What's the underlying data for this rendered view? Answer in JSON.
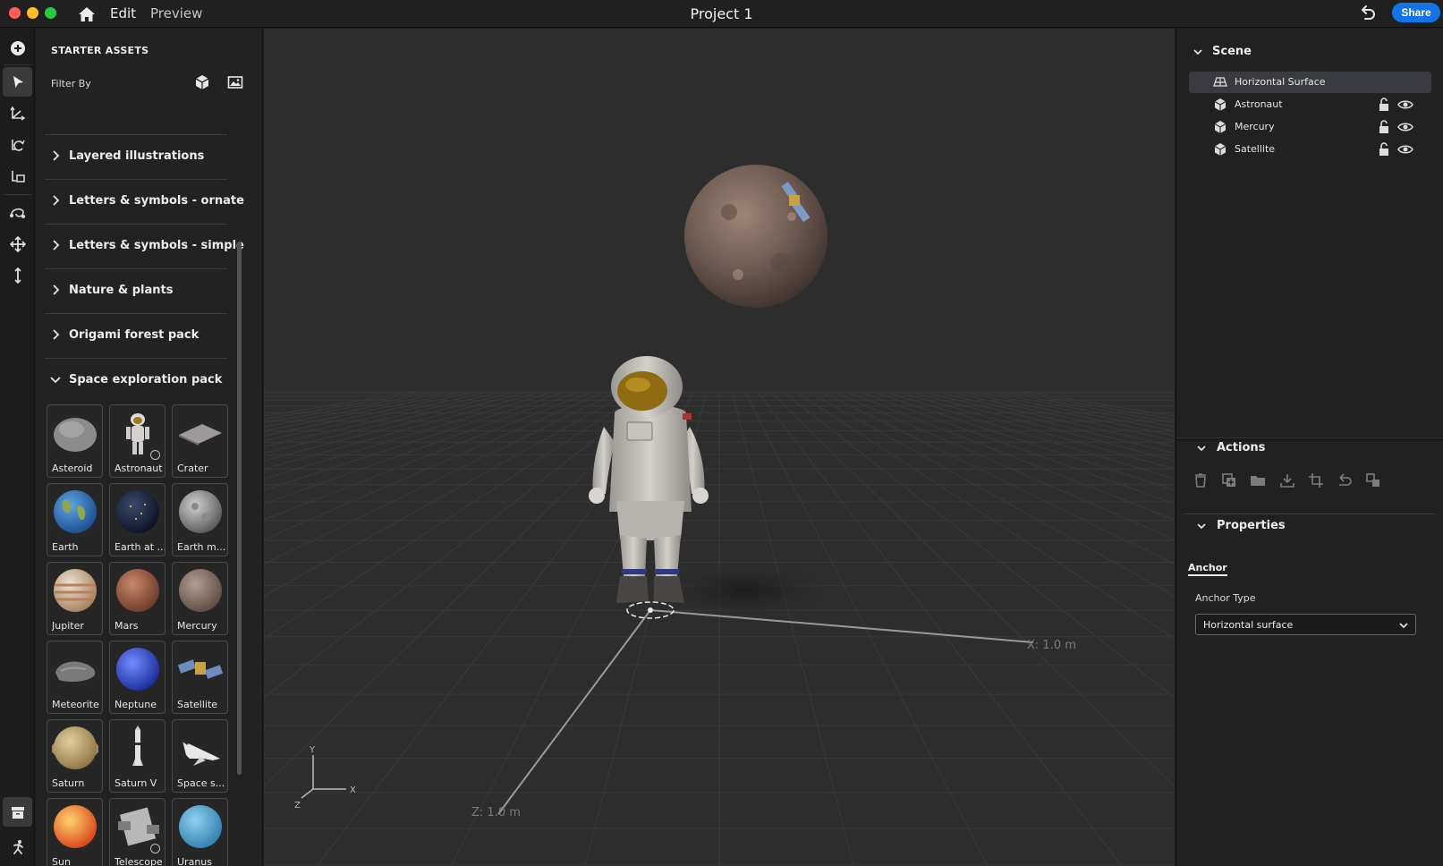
{
  "titlebar": {
    "menu": [
      "Edit",
      "Preview"
    ],
    "project_title": "Project 1",
    "share_label": "Share"
  },
  "assets": {
    "title": "STARTER ASSETS",
    "filter_label": "Filter By",
    "categories": [
      {
        "label": "Layered illustrations",
        "expanded": false
      },
      {
        "label": "Letters & symbols - ornate",
        "expanded": false
      },
      {
        "label": "Letters & symbols - simple",
        "expanded": false
      },
      {
        "label": "Nature & plants",
        "expanded": false
      },
      {
        "label": "Origami forest pack",
        "expanded": false
      },
      {
        "label": "Space exploration pack",
        "expanded": true
      }
    ],
    "tiles": [
      {
        "label": "Asteroid",
        "icon": "asteroid-icon"
      },
      {
        "label": "Astronaut",
        "icon": "astronaut-icon",
        "animated": true
      },
      {
        "label": "Crater",
        "icon": "crater-icon"
      },
      {
        "label": "Earth",
        "icon": "earth-icon"
      },
      {
        "label": "Earth at ...",
        "icon": "earth-night-icon"
      },
      {
        "label": "Earth m...",
        "icon": "earth-moon-icon"
      },
      {
        "label": "Jupiter",
        "icon": "jupiter-icon"
      },
      {
        "label": "Mars",
        "icon": "mars-icon"
      },
      {
        "label": "Mercury",
        "icon": "mercury-icon"
      },
      {
        "label": "Meteorite",
        "icon": "meteorite-icon"
      },
      {
        "label": "Neptune",
        "icon": "neptune-icon"
      },
      {
        "label": "Satellite",
        "icon": "satellite-icon"
      },
      {
        "label": "Saturn",
        "icon": "saturn-icon"
      },
      {
        "label": "Saturn V",
        "icon": "rocket-icon"
      },
      {
        "label": "Space s...",
        "icon": "space-shuttle-icon"
      },
      {
        "label": "Sun",
        "icon": "sun-icon"
      },
      {
        "label": "Telescope",
        "icon": "telescope-icon",
        "animated": true
      },
      {
        "label": "Uranus",
        "icon": "uranus-icon"
      }
    ]
  },
  "viewport": {
    "axis_x_label": "X: 1.0 m",
    "axis_z_label": "Z: 1.0 m",
    "gizmo": {
      "x": "X",
      "y": "Y",
      "z": "Z"
    }
  },
  "scene": {
    "title": "Scene",
    "items": [
      {
        "label": "Horizontal Surface",
        "icon": "surface-icon",
        "selected": true
      },
      {
        "label": "Astronaut",
        "icon": "cube-icon",
        "selected": false
      },
      {
        "label": "Mercury",
        "icon": "cube-icon",
        "selected": false
      },
      {
        "label": "Satellite",
        "icon": "cube-icon",
        "selected": false
      }
    ]
  },
  "actions": {
    "title": "Actions",
    "icons": [
      "trash-icon",
      "duplicate-icon",
      "group-folder-icon",
      "drop-to-ground-icon",
      "crop-icon",
      "reset-icon",
      "replace-icon"
    ]
  },
  "properties": {
    "title": "Properties",
    "tab": "Anchor",
    "anchor_type_label": "Anchor Type",
    "anchor_type_value": "Horizontal surface"
  },
  "colors": {
    "accent": "#1473e6",
    "panel": "#222222",
    "viewport": "#2d2d2d"
  }
}
